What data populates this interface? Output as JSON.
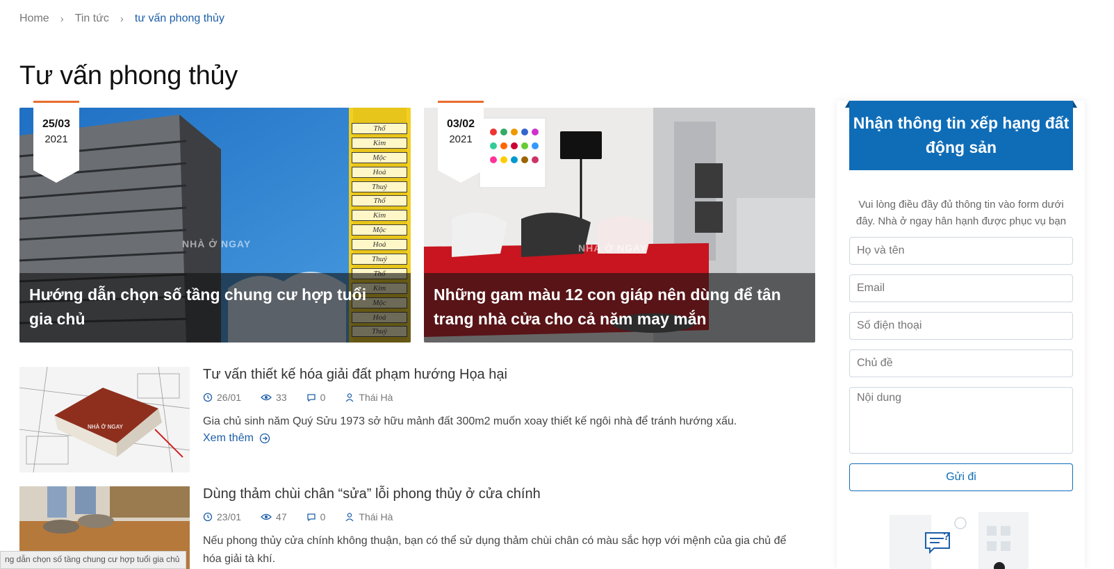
{
  "breadcrumb": {
    "home": "Home",
    "news": "Tin tức",
    "current": "tư vấn phong thủy"
  },
  "page": {
    "title": "Tư vấn phong thủy"
  },
  "featured": [
    {
      "day": "25/03",
      "year": "2021",
      "title": "Hướng dẫn chọn số tầng chung cư hợp tuổi gia chủ",
      "watermark": "NHÀ Ở NGAY",
      "tower_labels": [
        "Thổ",
        "Kim",
        "Mộc",
        "Hoả",
        "Thuỷ",
        "Thổ",
        "Kim",
        "Mộc",
        "Hoả",
        "Thuỷ",
        "Thổ",
        "Kim",
        "Mộc",
        "Hoả",
        "Thuỷ"
      ]
    },
    {
      "day": "03/02",
      "year": "2021",
      "title": "Những gam màu 12 con giáp nên dùng để tân trang nhà cửa cho cả năm may mắn",
      "watermark": "NHÀ Ở NGAY"
    }
  ],
  "posts": [
    {
      "title": "Tư vấn thiết kế hóa giải đất phạm hướng Họa hại",
      "date": "26/01",
      "views": "33",
      "comments": "0",
      "author": "Thái Hà",
      "excerpt": "Gia chủ sinh năm Quý Sửu 1973 sở hữu mảnh đất 300m2 muốn xoay thiết kế ngôi nhà để tránh hướng xấu.",
      "more": "Xem thêm",
      "watermark": "NHÀ Ở NGAY"
    },
    {
      "title": "Dùng thảm chùi chân “sửa” lỗi phong thủy ở cửa chính",
      "date": "23/01",
      "views": "47",
      "comments": "0",
      "author": "Thái Hà",
      "excerpt": "Nếu phong thủy cửa chính không thuận, bạn có thể sử dụng thảm chùi chân có màu sắc hợp với mệnh của gia chủ để hóa giải tà khí."
    }
  ],
  "sidebar": {
    "heading": "Nhận thông tin xếp hạng đất động sản",
    "note": "Vui lòng điều đầy đủ thông tin vào form dưới đây. Nhà ở ngay hân hạnh được phục vụ bạn",
    "fields": {
      "name": "Họ và tên",
      "email": "Email",
      "phone": "Số điện thoại",
      "subject": "Chủ đề",
      "content": "Nội dung"
    },
    "submit": "Gửi đi"
  },
  "status_tooltip": "ng dẫn chọn số tầng chung cư hợp tuổi gia chủ",
  "colors": {
    "accent": "#0f6db8",
    "link": "#1d5fa8",
    "date_bar": "#e86b2c"
  }
}
